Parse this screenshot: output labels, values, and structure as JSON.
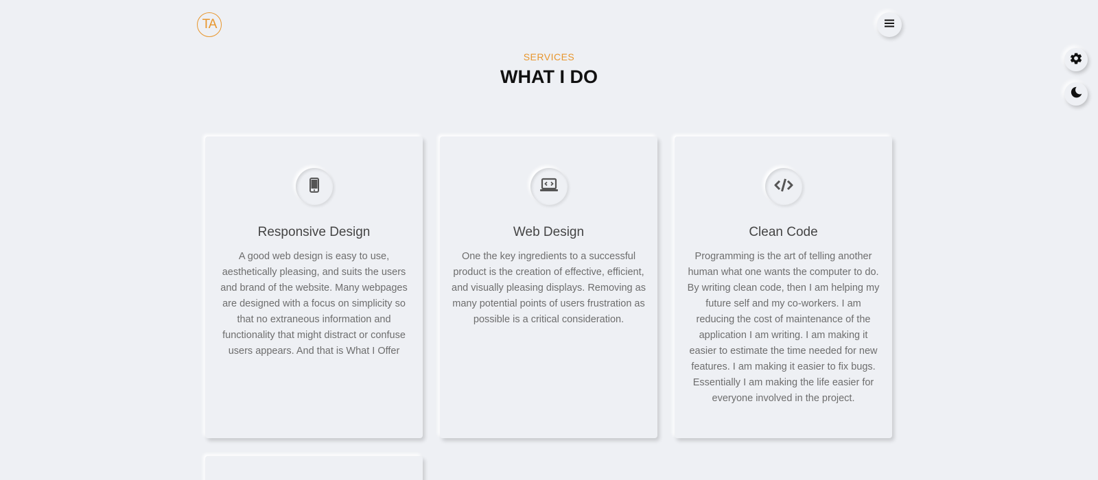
{
  "header": {
    "logo_text": "TA",
    "menu_icon": "hamburger-menu-icon"
  },
  "side_controls": {
    "settings_icon": "gear-icon",
    "theme_icon": "moon-icon"
  },
  "section": {
    "subtitle": "SERVICES",
    "title": "WHAT I DO"
  },
  "colors": {
    "accent": "#e8962c",
    "background": "#eef0f4",
    "heading": "#111111",
    "text": "#6d6d6d"
  },
  "services": [
    {
      "icon": "mobile-phone-icon",
      "title": "Responsive Design",
      "description": "A good web design is easy to use, aesthetically pleasing, and suits the users and brand of the website. Many webpages are designed with a focus on simplicity so that no extraneous information and functionality that might distract or confuse users appears. And that is What I Offer"
    },
    {
      "icon": "laptop-code-icon",
      "title": "Web Design",
      "description": "One the key ingredients to a successful product is the creation of effective, efficient, and visually pleasing displays. Removing as many potential points of users frustration as possible is a critical consideration."
    },
    {
      "icon": "code-icon",
      "title": "Clean Code",
      "description": "Programming is the art of telling another human what one wants the computer to do. By writing clean code, then I am helping my future self and my co-workers. I am reducing the cost of maintenance of the application I am writing. I am making it easier to estimate the time needed for new features. I am making it easier to fix bugs. Essentially I am making the life easier for everyone involved in the project."
    }
  ]
}
